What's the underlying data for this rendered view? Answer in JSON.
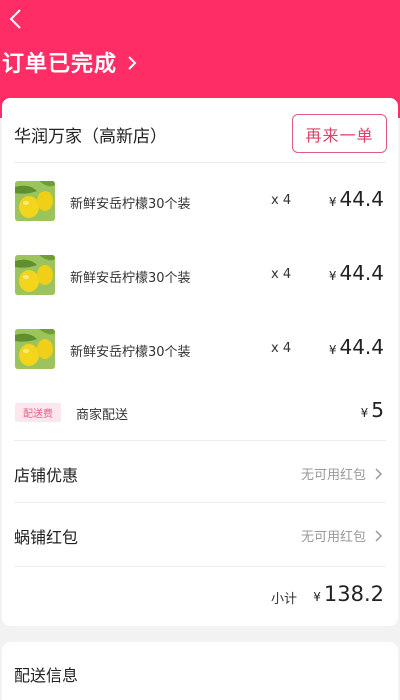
{
  "header": {
    "order_status": "订单已完成"
  },
  "store": {
    "name": "华润万家（高新店）",
    "reorder_label": "再来一单"
  },
  "items": [
    {
      "name": "新鲜安岳柠檬30个装",
      "qty": "x 4",
      "currency": "¥",
      "price": "44.4"
    },
    {
      "name": "新鲜安岳柠檬30个装",
      "qty": "x 4",
      "currency": "¥",
      "price": "44.4"
    },
    {
      "name": "新鲜安岳柠檬30个装",
      "qty": "x 4",
      "currency": "¥",
      "price": "44.4"
    }
  ],
  "delivery_fee": {
    "badge": "配送费",
    "label": "商家配送",
    "currency": "¥",
    "price": "5"
  },
  "discounts": {
    "store_label": "店铺优惠",
    "store_value": "无可用红包",
    "redpacket_label": "蜗铺红包",
    "redpacket_value": "无可用红包"
  },
  "subtotal": {
    "label": "小计",
    "currency": "¥",
    "value": "138.2"
  },
  "delivery_info": {
    "title": "配送信息"
  },
  "colors": {
    "brand": "#ff2d66",
    "accent_border": "#e05d80",
    "badge_bg": "#fde7ee",
    "badge_text": "#ee5b84"
  },
  "icons": {
    "back": "back-arrow-icon",
    "status_chevron": "chevron-right-icon",
    "row_chevron": "chevron-right-icon",
    "product": "lemon-image"
  }
}
